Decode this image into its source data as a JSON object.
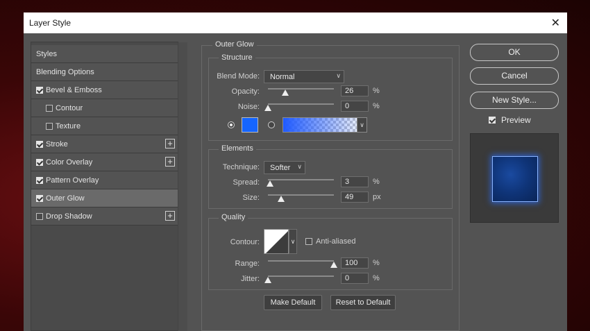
{
  "dialog": {
    "title": "Layer Style"
  },
  "style_list": [
    {
      "label": "Styles",
      "checkbox": null,
      "plus": false,
      "selected": false,
      "indent": false
    },
    {
      "label": "Blending Options",
      "checkbox": null,
      "plus": false,
      "selected": false,
      "indent": false
    },
    {
      "label": "Bevel & Emboss",
      "checkbox": true,
      "plus": false,
      "selected": false,
      "indent": false
    },
    {
      "label": "Contour",
      "checkbox": false,
      "plus": false,
      "selected": false,
      "indent": true
    },
    {
      "label": "Texture",
      "checkbox": false,
      "plus": false,
      "selected": false,
      "indent": true
    },
    {
      "label": "Stroke",
      "checkbox": true,
      "plus": true,
      "selected": false,
      "indent": false
    },
    {
      "label": "Color Overlay",
      "checkbox": true,
      "plus": true,
      "selected": false,
      "indent": false
    },
    {
      "label": "Pattern Overlay",
      "checkbox": true,
      "plus": false,
      "selected": false,
      "indent": false
    },
    {
      "label": "Outer Glow",
      "checkbox": true,
      "plus": false,
      "selected": true,
      "indent": false
    },
    {
      "label": "Drop Shadow",
      "checkbox": false,
      "plus": true,
      "selected": false,
      "indent": false
    }
  ],
  "outer_glow": {
    "title": "Outer Glow",
    "structure": {
      "title": "Structure",
      "blend_mode_label": "Blend Mode:",
      "blend_mode_value": "Normal",
      "opacity_label": "Opacity:",
      "opacity_value": "26",
      "opacity_fraction": 0.26,
      "noise_label": "Noise:",
      "noise_value": "0",
      "noise_fraction": 0.0,
      "percent": "%",
      "color_mode": "solid",
      "color": "#1565ff"
    },
    "elements": {
      "title": "Elements",
      "technique_label": "Technique:",
      "technique_value": "Softer",
      "spread_label": "Spread:",
      "spread_value": "3",
      "spread_fraction": 0.03,
      "size_label": "Size:",
      "size_value": "49",
      "size_fraction": 0.196,
      "percent": "%",
      "px": "px"
    },
    "quality": {
      "title": "Quality",
      "contour_label": "Contour:",
      "anti_aliased_label": "Anti-aliased",
      "anti_aliased": false,
      "range_label": "Range:",
      "range_value": "100",
      "range_fraction": 1.0,
      "jitter_label": "Jitter:",
      "jitter_value": "0",
      "jitter_fraction": 0.0,
      "percent": "%"
    },
    "make_default_label": "Make Default",
    "reset_default_label": "Reset to Default"
  },
  "actions": {
    "ok_label": "OK",
    "cancel_label": "Cancel",
    "new_style_label": "New Style...",
    "preview_label": "Preview",
    "preview_checked": true
  },
  "icons": {
    "close": "close-icon",
    "plus": "plus-icon",
    "chevron": "chevron-down-icon",
    "check": "checkmark-icon"
  }
}
